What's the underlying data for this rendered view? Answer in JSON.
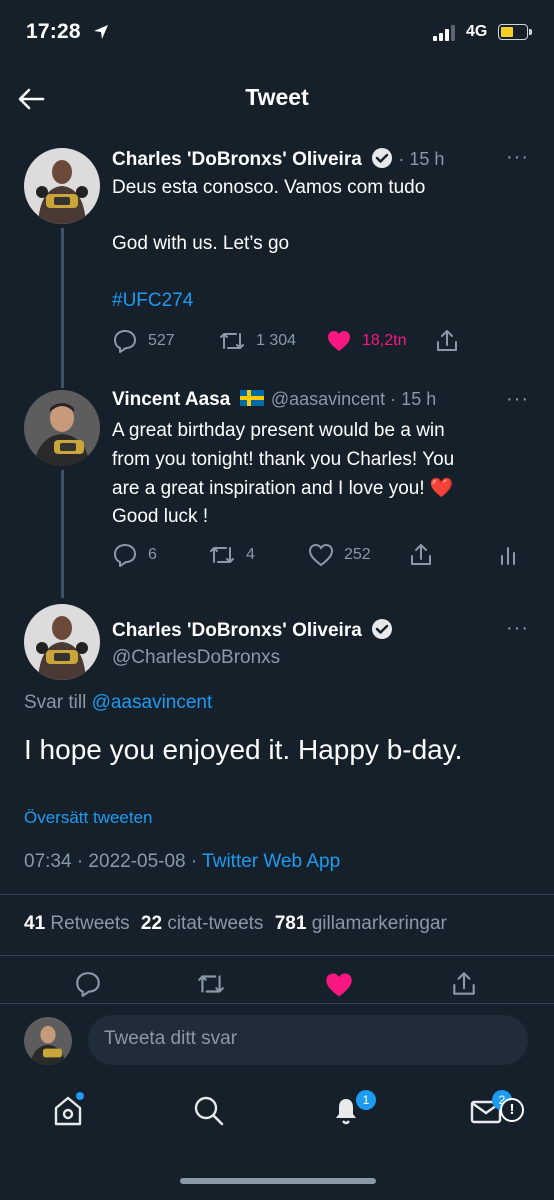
{
  "status_bar": {
    "time": "17:28",
    "network": "4G"
  },
  "header": {
    "title": "Tweet"
  },
  "tweet1": {
    "author": "Charles 'DoBronxs' Oliveira",
    "time": "· 15 h",
    "line1": "Deus esta conosco. Vamos com tudo",
    "line2": "God with us. Let’s go",
    "hashtag": "#UFC274",
    "replies": "527",
    "retweets": "1 304",
    "likes": "18,2tn"
  },
  "tweet2": {
    "author": "Vincent Aasa",
    "flag": "🇸🇪",
    "handle": "@aasavincent · 15 h",
    "line1": "A great birthday present would be a win",
    "line2": "from you tonight! thank you Charles! You",
    "line3": "are a great inspiration and I love you! ❤️",
    "line4": "Good luck !",
    "replies": "6",
    "retweets": "4",
    "likes": "252"
  },
  "main_tweet": {
    "author": "Charles 'DoBronxs' Oliveira",
    "handle": "@CharlesDoBronxs",
    "reply_prefix": "Svar till",
    "reply_to": "@aasavincent",
    "text": "I hope you enjoyed it. Happy b-day.",
    "translate": "Översätt tweeten",
    "timestamp": "07:34 · 2022-05-08 ·",
    "source": "Twitter Web App",
    "retweets_count": "41",
    "retweets_label": "Retweets",
    "quotes_count": "22",
    "quotes_label": "citat-tweets",
    "likes_count": "781",
    "likes_label": "gillamarkeringar"
  },
  "compose": {
    "placeholder": "Tweeta ditt svar"
  },
  "tabbar": {
    "notifications_badge": "1",
    "messages_badge": "2"
  },
  "colors": {
    "background": "#15202b",
    "accent": "#1d9bf0",
    "like": "#f91880",
    "muted": "#8b98a5"
  }
}
